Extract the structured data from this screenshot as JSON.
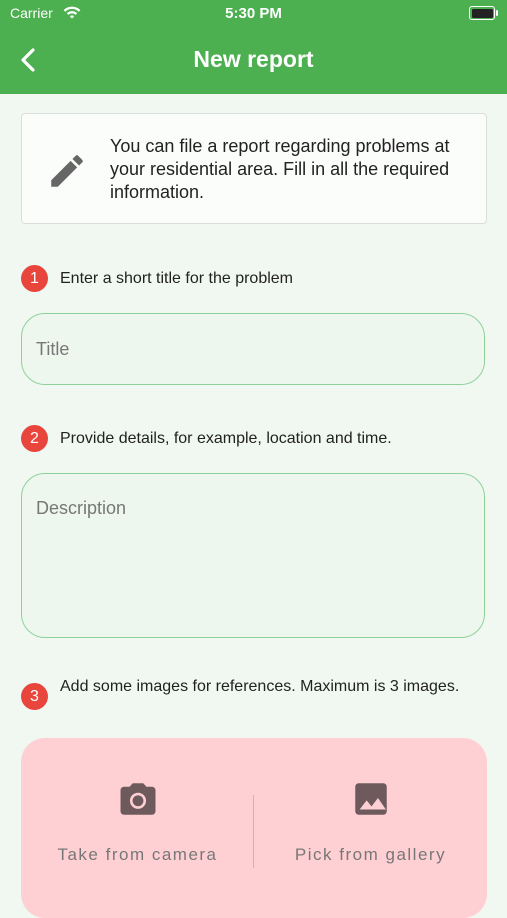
{
  "status_bar": {
    "carrier": "Carrier",
    "time": "5:30 PM"
  },
  "nav": {
    "title": "New report",
    "back_icon": "chevron-left-icon"
  },
  "info_card": {
    "icon": "pencil-icon",
    "text": "You can file a report regarding problems at your residential area. Fill in all the required information."
  },
  "steps": [
    {
      "number": "1",
      "text": "Enter a short title for the problem"
    },
    {
      "number": "2",
      "text": "Provide details, for example, location and time."
    },
    {
      "number": "3",
      "text": "Add some images for references. Maximum is 3 images."
    }
  ],
  "form": {
    "title_placeholder": "Title",
    "title_value": "",
    "description_placeholder": "Description",
    "description_value": ""
  },
  "image_options": {
    "camera_label": "Take from camera",
    "camera_icon": "camera-icon",
    "gallery_label": "Pick from gallery",
    "gallery_icon": "image-icon"
  },
  "colors": {
    "header": "#4caf50",
    "step_badge": "#e8453c",
    "input_border": "#8fd19a",
    "image_panel": "#ffd0d3"
  }
}
